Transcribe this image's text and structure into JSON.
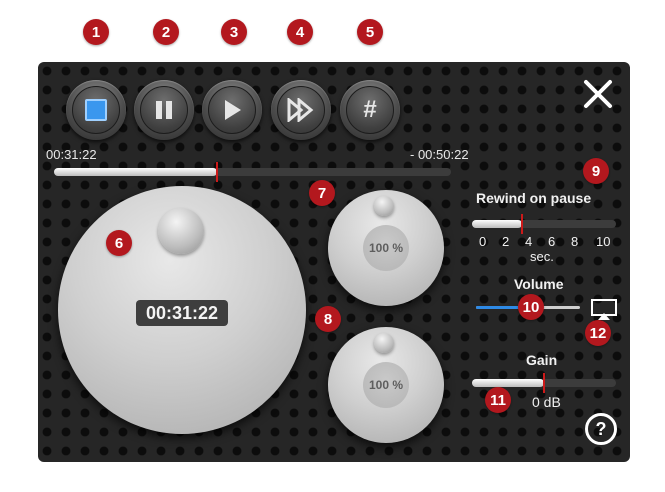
{
  "markers": [
    "1",
    "2",
    "3",
    "4",
    "5",
    "6",
    "7",
    "8",
    "9",
    "10",
    "11",
    "12"
  ],
  "transport": {
    "buttons": [
      {
        "name": "stop-button",
        "icon": "stop-icon"
      },
      {
        "name": "pause-button",
        "icon": "pause-icon"
      },
      {
        "name": "play-button",
        "icon": "play-icon"
      },
      {
        "name": "fast-forward-button",
        "icon": "fast-forward-icon"
      },
      {
        "name": "marker-button",
        "icon": "hash-icon",
        "glyph": "#"
      }
    ],
    "accent_color": "#2e8ae6"
  },
  "position": {
    "elapsed": "00:31:22",
    "remaining": "- 00:50:22",
    "progress_fraction": 0.41
  },
  "jog": {
    "display": "00:31:22"
  },
  "speed_knobs": [
    {
      "label": "100 %"
    },
    {
      "label": "100 %"
    }
  ],
  "rewind": {
    "title": "Rewind on pause",
    "scale": [
      "0",
      "2",
      "4",
      "6",
      "8",
      "10"
    ],
    "unit": "sec.",
    "value_sec": 3.5
  },
  "volume": {
    "title": "Volume",
    "level_fraction": 0.5
  },
  "gain": {
    "title": "Gain",
    "value_text": "0 dB",
    "level_fraction": 0.5
  },
  "colors": {
    "marker": "#b3181e",
    "indicator": "#cc1a1a",
    "volume_fill": "#2e8ae6"
  }
}
